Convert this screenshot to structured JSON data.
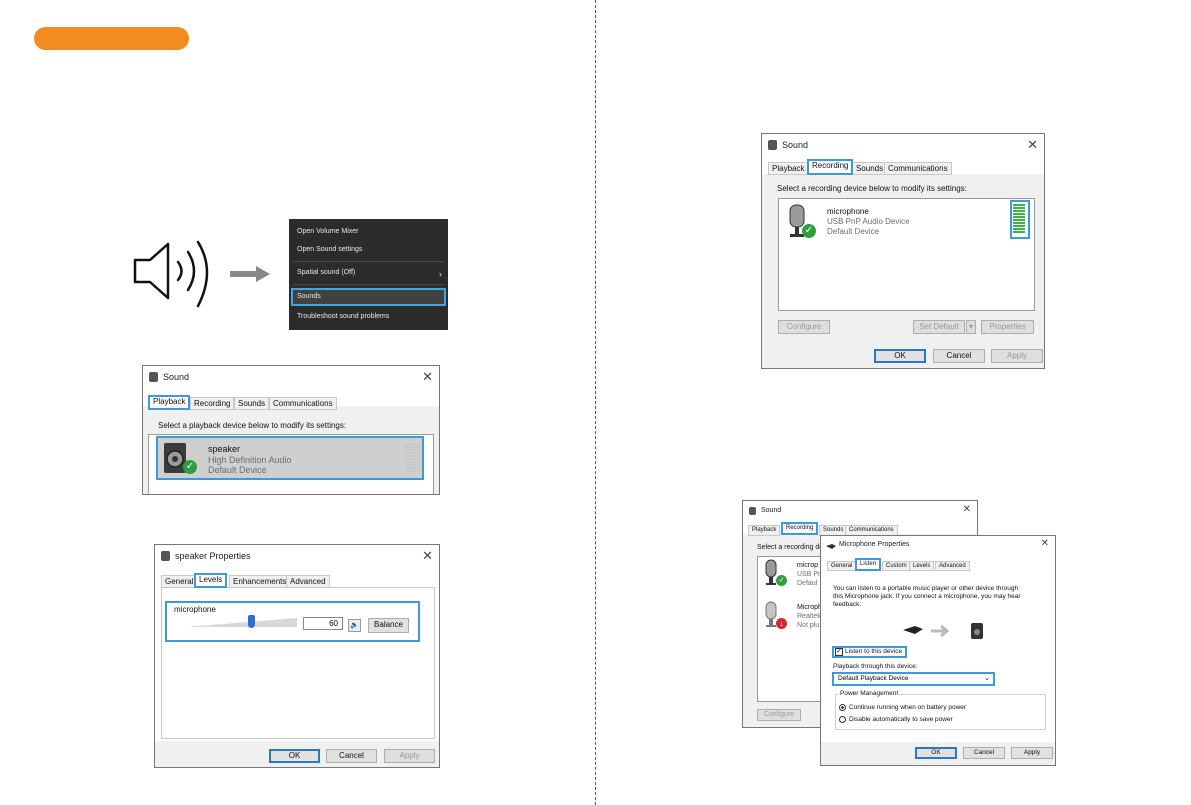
{
  "context_menu": {
    "items": [
      "Open Volume Mixer",
      "Open Sound settings",
      "Spatial sound (Off)",
      "Sounds",
      "Troubleshoot sound problems"
    ]
  },
  "playback_dialog": {
    "title": "Sound",
    "tabs": [
      "Playback",
      "Recording",
      "Sounds",
      "Communications"
    ],
    "instruction": "Select a playback device below to modify its settings:",
    "device": {
      "name": "speaker",
      "driver": "High Definition Audio",
      "status": "Default Device"
    }
  },
  "speaker_props": {
    "title": "speaker Properties",
    "tabs": [
      "General",
      "Levels",
      "Enhancements",
      "Advanced"
    ],
    "group_label": "microphone",
    "volume_value": "60",
    "volume_level": 0.6,
    "balance_label": "Balance",
    "ok": "OK",
    "cancel": "Cancel",
    "apply": "Apply"
  },
  "recording_dialog": {
    "title": "Sound",
    "tabs": [
      "Playback",
      "Recording",
      "Sounds",
      "Communications"
    ],
    "instruction": "Select a recording device below to modify its settings:",
    "device": {
      "name": "microphone",
      "driver": "USB PnP Audio Device",
      "status": "Default Device"
    },
    "configure": "Configure",
    "set_default": "Set Default",
    "properties": "Properties",
    "ok": "OK",
    "cancel": "Cancel",
    "apply": "Apply"
  },
  "back_dialog": {
    "title": "Sound",
    "tabs": [
      "Playback",
      "Recording",
      "Sounds",
      "Communications"
    ],
    "instruction": "Select a recording de",
    "devices": [
      {
        "name": "microp",
        "driver": "USB Pn",
        "status": "Defaul"
      },
      {
        "name": "Microph",
        "driver": "Realtek",
        "status": "Not plu"
      }
    ],
    "configure": "Configure"
  },
  "mic_props": {
    "title": "Microphone Properties",
    "tabs": [
      "General",
      "Listen",
      "Custom",
      "Levels",
      "Advanced"
    ],
    "description": [
      "You can listen to a portable music player or other device through",
      "this Microphone jack.  If you connect a microphone, you may hear",
      "feedback."
    ],
    "listen_checkbox": "Listen to this device",
    "playback_label": "Playback through this device:",
    "playback_value": "Default Playback Device",
    "power_group": "Power Management",
    "radio1": "Continue running when on battery power",
    "radio2": "Disable automatically to save power",
    "ok": "OK",
    "cancel": "Cancel",
    "apply": "Apply"
  },
  "colors": {
    "accent_orange": "#F28C1E",
    "highlight_blue": "#3D9AD6",
    "meter_green": "#3FB24A"
  }
}
